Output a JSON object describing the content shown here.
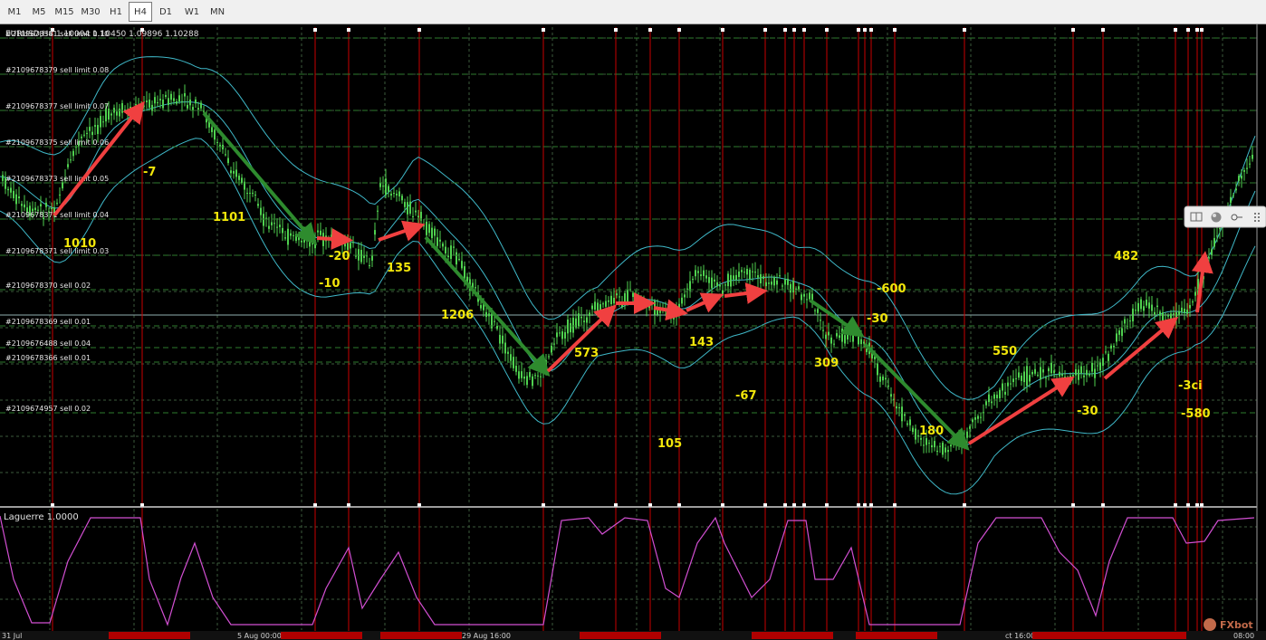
{
  "toolbar": {
    "timeframes": [
      "M1",
      "M5",
      "M15",
      "M30",
      "H1",
      "H4",
      "D1",
      "W1",
      "MN"
    ],
    "active": "H4"
  },
  "colors": {
    "background": "#000000",
    "grid": "#3b5a3b",
    "candle": "#4fd14f",
    "band": "#3fb8c8",
    "vline": "#c80000",
    "label": "#f2e60a",
    "laguerre": "#d24fd2",
    "arrow_red": "#f04040",
    "arrow_green": "#2e8b2e"
  },
  "chart": {
    "header": "EURUSD,H4  1.10004 1.10450 1.09896 1.10288",
    "order_lines": [
      "#2109678381 sell limit 0.10",
      "#2109678379 sell limit 0.08",
      "#2109678377 sell limit 0.07",
      "#2109678375 sell limit 0.06",
      "#2109678373 sell limit 0.05",
      "#2109678371 sell limit 0.04",
      "#2109678371 sell limit 0.03",
      "#2109678370 sell 0.02",
      "#2109678369 sell 0.01",
      "#2109676488 sell 0.04",
      "#2109678366 sell 0.01",
      "#2109674957 sell 0.02"
    ],
    "profit_labels": [
      "1010",
      "-7",
      "1101",
      "-20",
      "-10",
      "135",
      "1206",
      "573",
      "105",
      "143",
      "-67",
      "309",
      "-600",
      "-30",
      "180",
      "550",
      "-30",
      "482",
      "-3ci",
      "-580"
    ],
    "axis_dates": [
      "31 Jul",
      "5 Aug 00:00",
      "29 Aug 16:00",
      "ct 16:00",
      "08:00"
    ]
  },
  "laguerre": {
    "label": "Laguerre 1.0000"
  },
  "watermark": "FXbot",
  "mini_toolbar": {
    "icons": [
      "window-icon",
      "ball-icon",
      "key-icon",
      "grip-icon"
    ]
  }
}
